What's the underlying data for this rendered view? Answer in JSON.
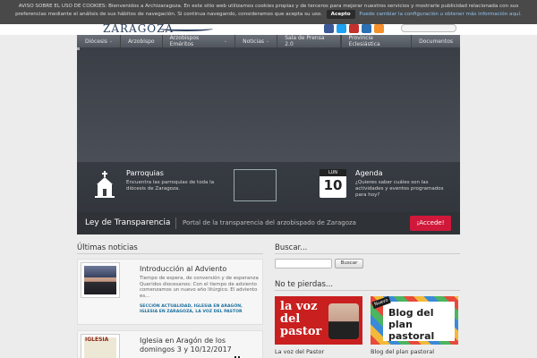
{
  "cookie_bar": {
    "text": "AVISO SOBRE EL USO DE COOKIES: Bienvenidos a Archizaragoza. En este sitio web utilizamos cookies propias y de terceros para mejorar nuestros servicios y mostrarle publicidad relacionada con sus preferencias mediante el análisis de sus hábitos de navegación. Si continua navegando, consideramos que acepta su uso.",
    "accept_label": "Acepto",
    "config_link": "Puede cambiar la configuración u obtener más información aquí."
  },
  "header": {
    "logo_text": "ZARAGOZA",
    "social_colors": [
      "#3b5998",
      "#1da1f2",
      "#c4302b",
      "#2b6fb5",
      "#f5902b"
    ]
  },
  "nav": {
    "items": [
      {
        "label": "Diócesis",
        "dropdown": true
      },
      {
        "label": "Arzobispo",
        "dropdown": false
      },
      {
        "label": "Arzobispos Eméritos",
        "dropdown": true
      },
      {
        "label": "Noticias",
        "dropdown": true
      },
      {
        "label": "Sala de Prensa 2.0",
        "dropdown": false
      }
    ],
    "right_items": [
      "Provincia Eclesiástica",
      "Documentos"
    ]
  },
  "hero": {
    "parroquias": {
      "title": "Parroquias",
      "text": "Encuentra las parroquias de toda la diócesis de Zaragoza."
    },
    "agenda": {
      "title": "Agenda",
      "text": "¿Quieres saber cuáles son las actividades y eventos programados para hoy?",
      "cal_day": "LUN",
      "cal_num": "10"
    },
    "transparency": {
      "title": "Ley de Transparencia",
      "desc": "Portal de la transparencia del arzobispado de Zaragoza",
      "button": "¡Accede!"
    }
  },
  "news": {
    "title": "Últimas noticias",
    "items": [
      {
        "headline": "Introducción al Adviento",
        "body": "Tiempo de espera, de conversión y de esperanza Queridos diocesanos: Con el tiempo de adviento comenzamos un nuevo año litúrgico. El adviento es...",
        "cats": "SECCIÓN ACTUALIDAD, IGLESIA EN ARAGÓN, IGLESIA EN ZARAGOZA, LA VOZ DEL PASTOR"
      },
      {
        "headline": "Iglesia en Aragón de los domingos 3 y 10/12/2017",
        "thumb_label": "IGLESIA"
      }
    ]
  },
  "search": {
    "title": "Buscar...",
    "button": "Buscar"
  },
  "miss": {
    "title": "No te pierdas...",
    "promo1": {
      "big": "la voz del pastor",
      "caption": "La voz del Pastor"
    },
    "promo2": {
      "big": "Blog del plan pastoral",
      "badge": "Nuevo",
      "caption": "Blog del plan pastoral"
    }
  }
}
